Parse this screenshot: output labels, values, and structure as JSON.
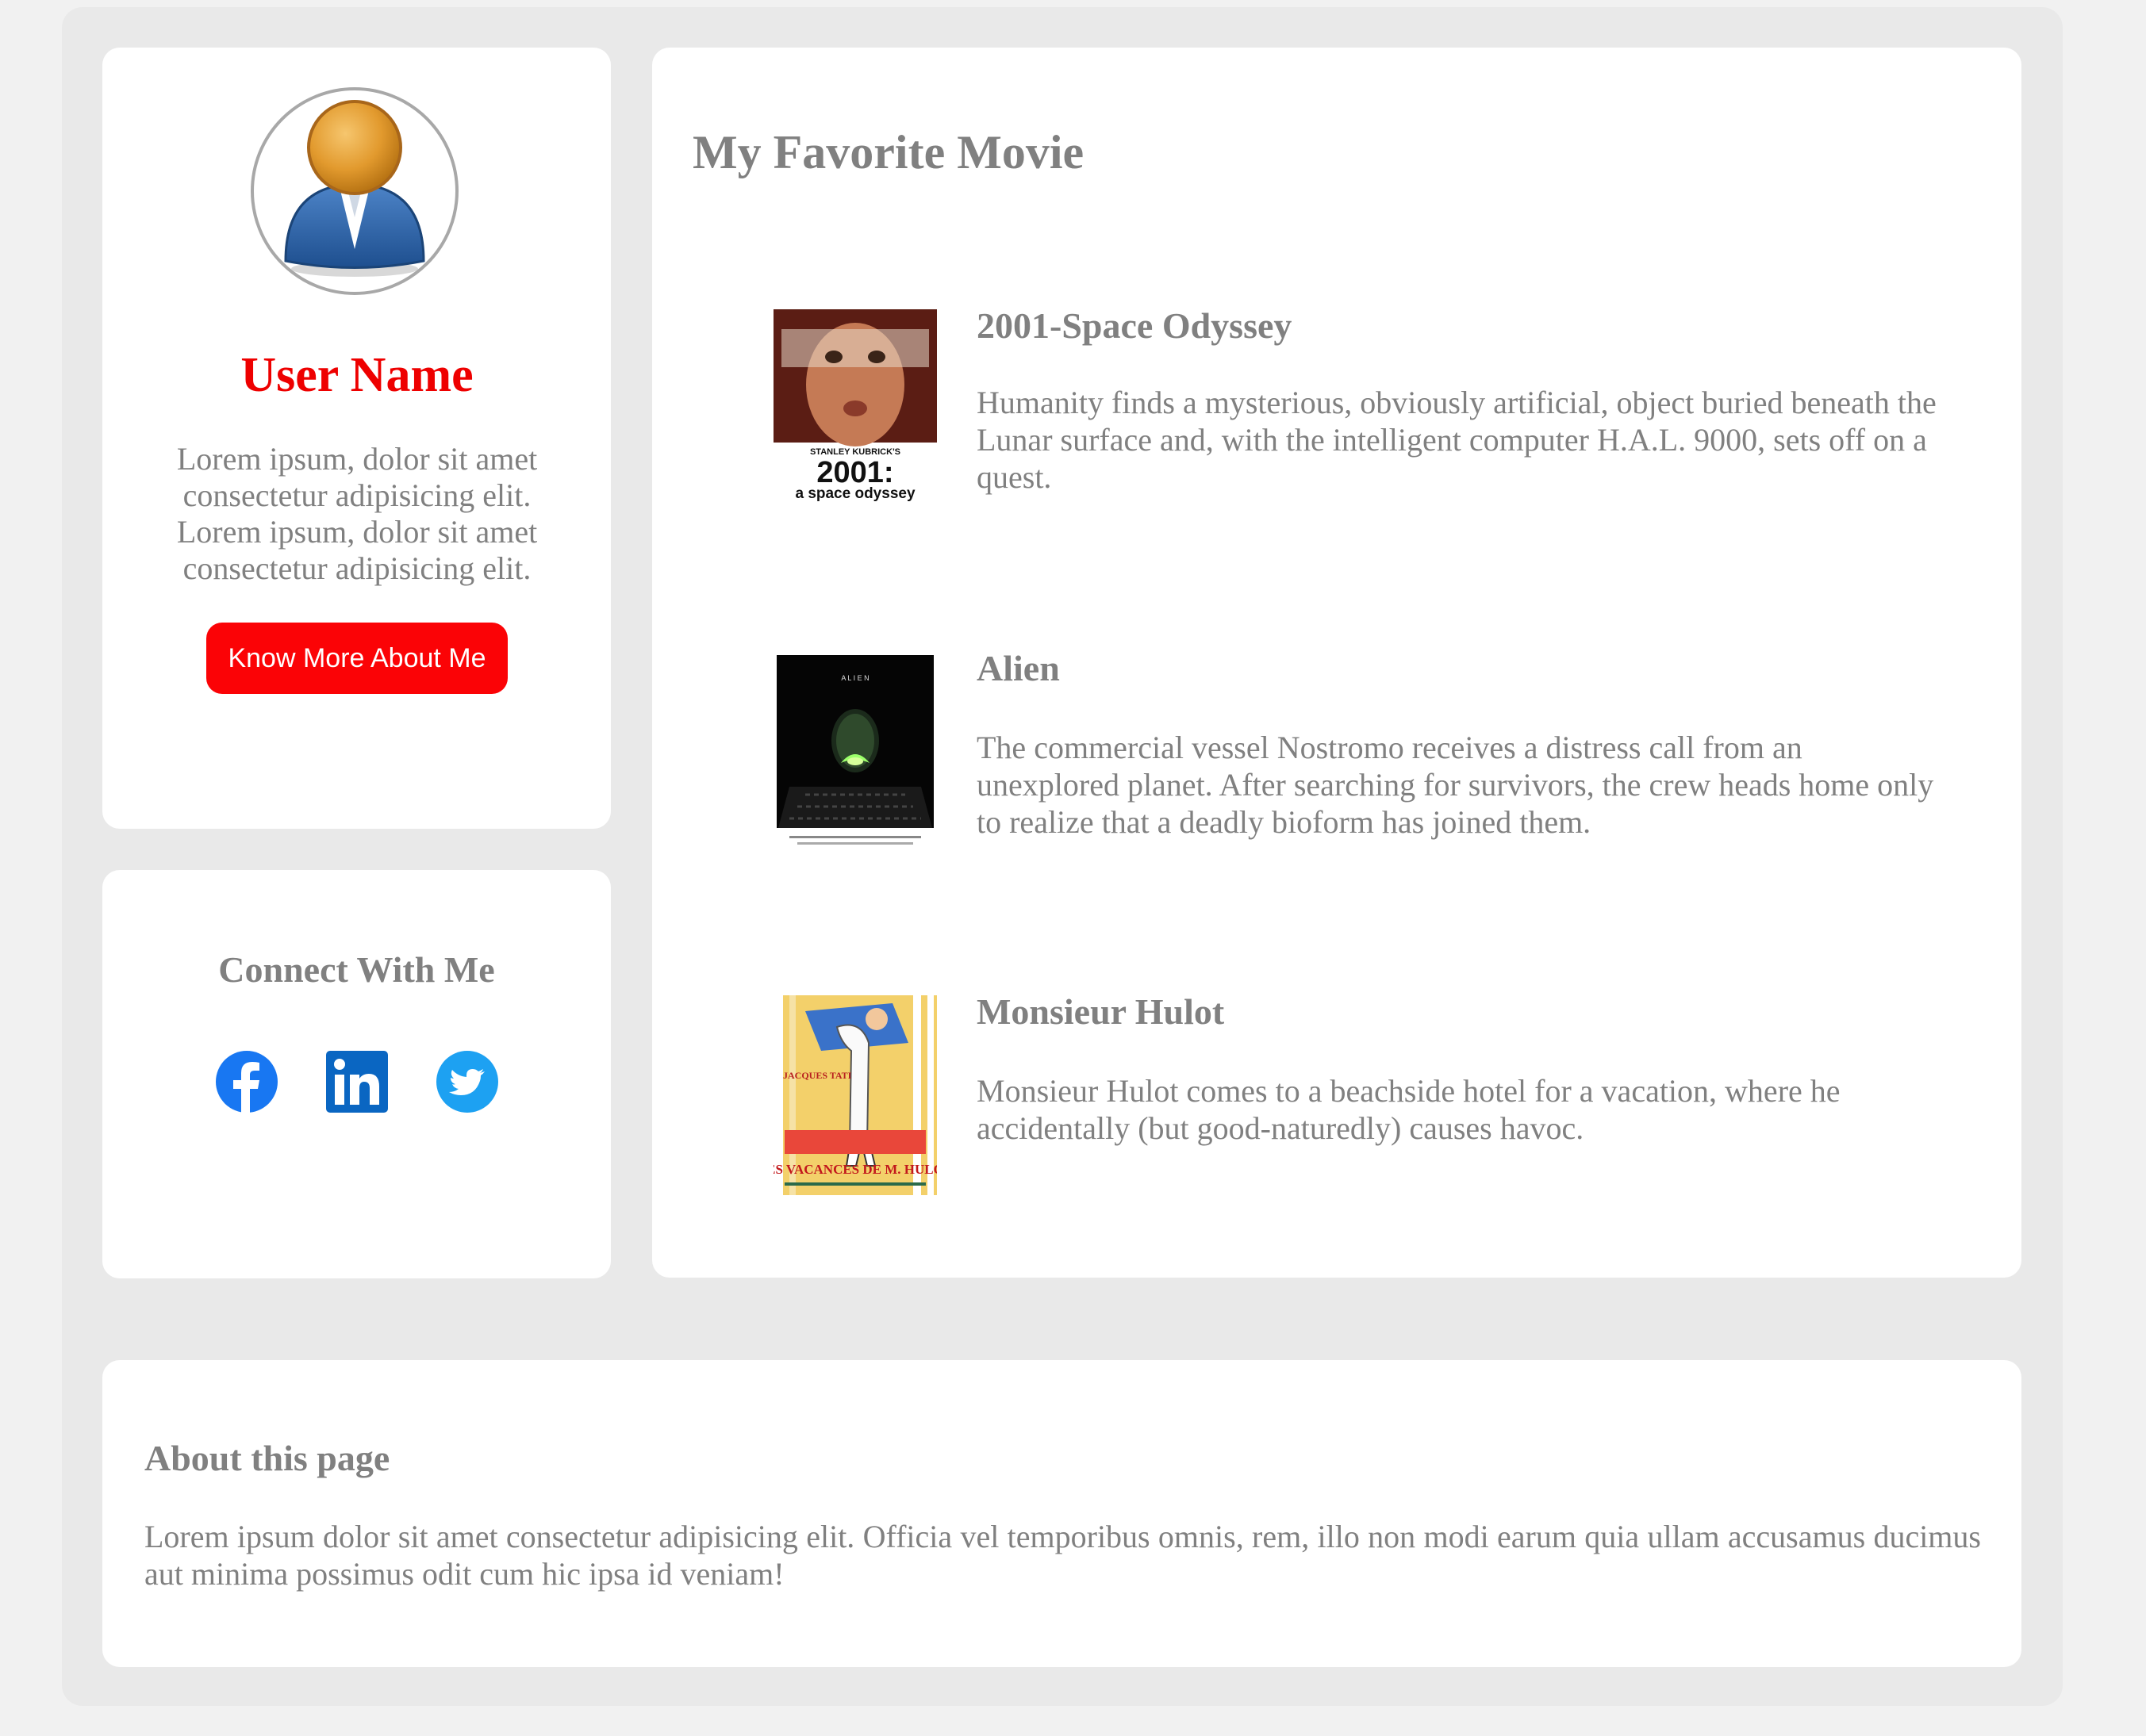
{
  "profile": {
    "user_name": "User Name",
    "bio": "Lorem ipsum, dolor sit amet consectetur adipisicing elit. Lorem ipsum, dolor sit amet consectetur adipisicing elit.",
    "button_label": "Know More About Me",
    "avatar_icon": "user-avatar-icon"
  },
  "connect": {
    "title": "Connect With Me",
    "icons": [
      "facebook-icon",
      "linkedin-icon",
      "twitter-icon"
    ],
    "colors": {
      "facebook": "#1877f2",
      "linkedin": "#0a66c2",
      "twitter": "#1da1f2"
    }
  },
  "movies": {
    "title": "My Favorite Movie",
    "items": [
      {
        "title": "2001-Space Odyssey",
        "description": "Humanity finds a mysterious, obviously artificial, object buried beneath the Lunar surface and, with the intelligent computer H.A.L. 9000, sets off on a quest.",
        "poster": {
          "line1": "STANLEY KUBRICK'S",
          "line2": "2001:",
          "line3": "a space odyssey"
        }
      },
      {
        "title": "Alien",
        "description": "The commercial vessel Nostromo receives a distress call from an unexplored planet. After searching for survivors, the crew heads home only to realize that a deadly bioform has joined them.",
        "poster": {
          "line1": "A L I E N"
        }
      },
      {
        "title": "Monsieur Hulot",
        "description": "Monsieur Hulot comes to a beachside hotel for a vacation, where he accidentally (but good-naturedly) causes havoc.",
        "poster": {
          "line1": "JACQUES TATI",
          "line2": "LES VACANCES DE M. HULOT"
        }
      }
    ]
  },
  "about": {
    "title": "About this page",
    "text": "Lorem ipsum dolor sit amet consectetur adipisicing elit. Officia vel temporibus omnis, rem, illo non modi earum quia ullam accusamus ducimus aut minima possimus odit cum hic ipsa id veniam!"
  },
  "theme": {
    "accent": "#fb0306",
    "name_color": "#ee0000",
    "text_gray": "#808080",
    "page_bg": "#f1f1f1",
    "panel_bg": "#e9e9e9"
  }
}
